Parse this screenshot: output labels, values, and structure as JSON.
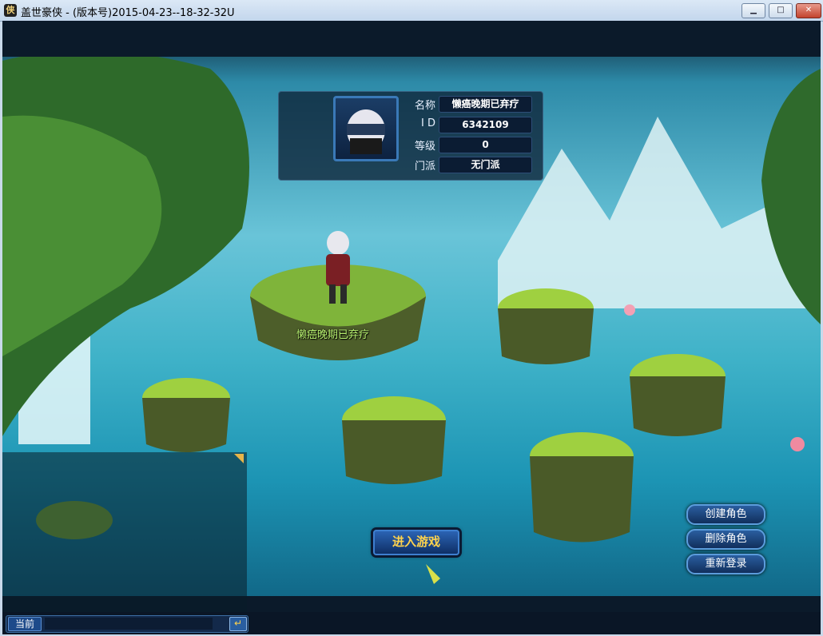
{
  "window": {
    "title": "盖世豪侠 - (版本号)2015-04-23--18-32-32U",
    "icon_glyph": "侠",
    "minimize": "▁",
    "maximize": "□",
    "close": "✕"
  },
  "character": {
    "labels": {
      "name": "名称",
      "id": "I D",
      "level": "等级",
      "sect": "门派"
    },
    "name": "懒癌晚期已弃疗",
    "id": "6342109",
    "level": "0",
    "sect": "无门派"
  },
  "scene_name_tag": "懒癌晚期已弃疗",
  "buttons": {
    "enter_game": "进入游戏",
    "create_role": "创建角色",
    "delete_role": "删除角色",
    "relogin": "重新登录"
  },
  "chat": {
    "channel": "当前",
    "input_value": "",
    "send_icon": "↵"
  },
  "colors": {
    "accent_blue": "#2b63b3",
    "gold_text": "#ffd34d",
    "name_green": "#b8f270"
  }
}
